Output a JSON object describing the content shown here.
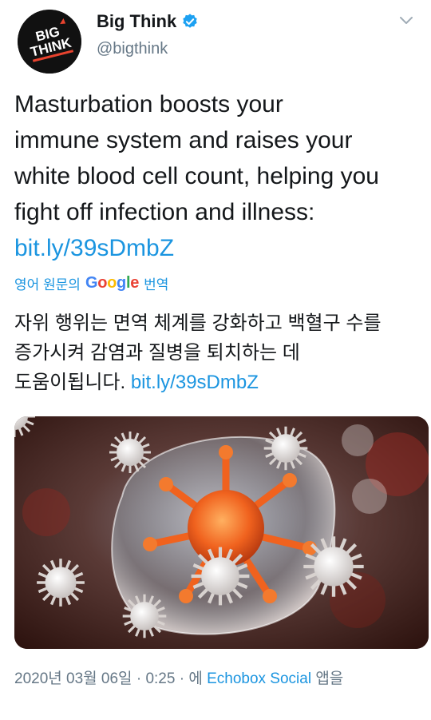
{
  "tweet": {
    "avatar_text": [
      "BIG",
      "THINK"
    ],
    "display_name": "Big Think",
    "handle": "@bigthink",
    "text_lines": [
      "Masturbation boosts your",
      "immune system and raises your",
      "white blood cell count, helping you",
      "fight off infection and illness:"
    ],
    "link": "bit.ly/39sDmbZ",
    "translation_prefix": "영어 원문의",
    "translation_google": [
      "G",
      "o",
      "o",
      "g",
      "l",
      "e"
    ],
    "translation_suffix": "번역",
    "translated_lines": [
      "자위 행위는 면역 체계를 강화하고 백혈구 수를",
      "증가시켜 감염과 질병을 퇴치하는 데",
      "도움이됩니다."
    ],
    "translated_link": "bit.ly/39sDmbZ",
    "date": "2020년 03월 06일",
    "sep1": "·",
    "time": "0:25",
    "sep2": "·",
    "via_prefix": "에",
    "app_name": "Echobox Social",
    "via_suffix": "앱을"
  },
  "colors": {
    "link": "#1b95e0",
    "muted": "#657786",
    "text": "#14171a"
  },
  "icons": {
    "verified": "verified-badge-icon",
    "chevron": "chevron-down-icon"
  }
}
